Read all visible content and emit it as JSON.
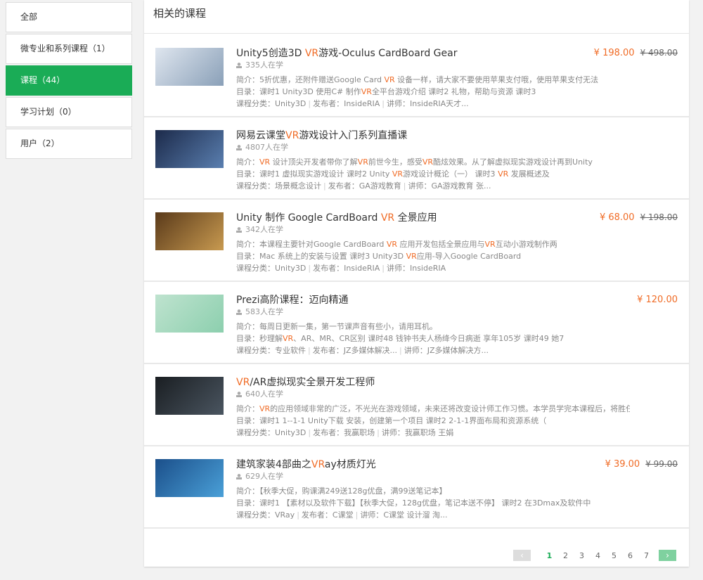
{
  "sidebar": {
    "items": [
      {
        "label": "全部",
        "active": false
      },
      {
        "label": "微专业和系列课程（1）",
        "active": false
      },
      {
        "label": "课程（44）",
        "active": true
      },
      {
        "label": "学习计划（0）",
        "active": false
      },
      {
        "label": "用户（2）",
        "active": false
      }
    ]
  },
  "main": {
    "title": "相关的课程"
  },
  "labels": {
    "intro": "简介：",
    "toc": "目录：",
    "category": "课程分类：",
    "publisher": "发布者：",
    "teacher": "讲师："
  },
  "courses": [
    {
      "title": [
        [
          "Unity5创造3D ",
          0
        ],
        [
          "VR",
          1
        ],
        [
          "游戏-Oculus CardBoard Gear",
          0
        ]
      ],
      "learners": "335人在学",
      "intro": [
        [
          "5折优惠，还附件赠送Google Card ",
          0
        ],
        [
          "VR",
          1
        ],
        [
          " 设备一样，请大家不要使用苹果支付哦，使用苹果支付无法",
          0
        ]
      ],
      "toc": [
        [
          "课时1 Unity3D 使用C# 制作",
          0
        ],
        [
          "VR",
          1
        ],
        [
          "全平台游戏介绍 课时2 礼物，帮助与资源 课时3",
          0
        ]
      ],
      "category": "Unity3D",
      "publisher": "InsideRIA",
      "teacher": "InsideRIA天才...",
      "price": "¥ 198.00",
      "old_price": "¥ 498.00",
      "thumb": [
        "#dfe6ef",
        "#8aa0b8"
      ]
    },
    {
      "title": [
        [
          "网易云课堂",
          0
        ],
        [
          "VR",
          1
        ],
        [
          "游戏设计入门系列直播课",
          0
        ]
      ],
      "learners": "4807人在学",
      "intro": [
        [
          "VR",
          1
        ],
        [
          " 设计顶尖开发者带你了解",
          0
        ],
        [
          "VR",
          1
        ],
        [
          "前世今生，感受",
          0
        ],
        [
          "VR",
          1
        ],
        [
          "酷炫效果。从了解虚拟现实游戏设计再到Unity",
          0
        ]
      ],
      "toc": [
        [
          "课时1 虚拟现实游戏设计 课时2 Unity ",
          0
        ],
        [
          "VR",
          1
        ],
        [
          "游戏设计概论（一） 课时3 ",
          0
        ],
        [
          "VR",
          1
        ],
        [
          " 发展概述及",
          0
        ]
      ],
      "category": "场景概念设计",
      "publisher": "GA游戏教育",
      "teacher": "GA游戏教育 张...",
      "price": "",
      "old_price": "",
      "thumb": [
        "#1c2a4a",
        "#5a7fb0"
      ]
    },
    {
      "title": [
        [
          "Unity 制作 Google CardBoard ",
          0
        ],
        [
          "VR",
          1
        ],
        [
          " 全景应用",
          0
        ]
      ],
      "learners": "342人在学",
      "intro": [
        [
          "本课程主要针对Google CardBoard ",
          0
        ],
        [
          "VR",
          1
        ],
        [
          " 应用开发包括全景应用与",
          0
        ],
        [
          "VR",
          1
        ],
        [
          "互动小游戏制作两",
          0
        ]
      ],
      "toc": [
        [
          "Mac 系统上的安装与设置 课时3 Unity3D ",
          0
        ],
        [
          "VR",
          1
        ],
        [
          "应用-导入Google CardBoard",
          0
        ]
      ],
      "category": "Unity3D",
      "publisher": "InsideRIA",
      "teacher": "InsideRIA",
      "price": "¥ 68.00",
      "old_price": "¥ 198.00",
      "thumb": [
        "#5a3a1a",
        "#c89a50"
      ]
    },
    {
      "title": [
        [
          "Prezi高阶课程：迈向精通",
          0
        ]
      ],
      "learners": "583人在学",
      "intro": [
        [
          "每周日更新一集，第一节课声音有些小，请用耳机。",
          0
        ]
      ],
      "toc": [
        [
          "秒理解",
          0
        ],
        [
          "VR",
          1
        ],
        [
          "、AR、MR、CR区别 课时48 钱钟书夫人杨绛今日病逝 享年105岁 课时49 她7",
          0
        ]
      ],
      "category": "专业软件",
      "publisher": "JZ多媒体解决...",
      "teacher": "JZ多媒体解决方...",
      "price": "¥ 120.00",
      "old_price": "",
      "thumb": [
        "#bfe3cf",
        "#8ccfae"
      ]
    },
    {
      "title": [
        [
          "VR",
          1
        ],
        [
          "/AR虚拟现实全景开发工程师",
          0
        ]
      ],
      "learners": "640人在学",
      "intro": [
        [
          "VR",
          1
        ],
        [
          "的应用领域非常的广泛，不光光在游戏领域，未来还将改变设计师工作习惯。本学员学完本课程后，将胜任",
          0
        ]
      ],
      "toc": [
        [
          "课时1 1--1-1 Unity下载 安装，创建第一个项目 课时2 2-1-1界面布局和资源系统（",
          0
        ]
      ],
      "category": "Unity3D",
      "publisher": "我赢职场",
      "teacher": "我赢职场 王娟",
      "price": "",
      "old_price": "",
      "thumb": [
        "#1a1e22",
        "#4a5560"
      ]
    },
    {
      "title": [
        [
          "建筑家装4部曲之",
          0
        ],
        [
          "VR",
          1
        ],
        [
          "ay材质灯光",
          0
        ]
      ],
      "learners": "629人在学",
      "intro": [
        [
          "【秋季大促，购课满249送128g优盘，满99送笔记本】",
          0
        ]
      ],
      "toc": [
        [
          "课时1 【素材以及软件下载】【秋季大促，128g优盘，笔记本送不停】 课时2 在3Dmax及软件中",
          0
        ]
      ],
      "category": "VRay",
      "publisher": "C课堂",
      "teacher": "C课堂 设计溜 淘...",
      "price": "¥ 39.00",
      "old_price": "¥ 99.00",
      "thumb": [
        "#1b4f8a",
        "#4aa0d8"
      ]
    }
  ],
  "pagination": {
    "pages": [
      "1",
      "2",
      "3",
      "4",
      "5",
      "6",
      "7"
    ],
    "current": "1",
    "prev": "‹",
    "next": "›"
  }
}
